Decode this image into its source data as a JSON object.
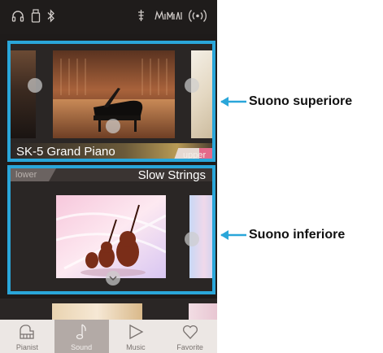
{
  "status_bar": {
    "icons": [
      "headphones-icon",
      "usb-memory-icon",
      "bluetooth-icon",
      "metronome-icon",
      "recorder-icon",
      "wireless-icon"
    ]
  },
  "upper_panel": {
    "name": "SK-5 Grand Piano",
    "tag": "upper"
  },
  "lower_panel": {
    "name": "Slow Strings",
    "tag": "lower"
  },
  "nav": {
    "items": [
      {
        "label": "Pianist",
        "icon": "piano-icon"
      },
      {
        "label": "Sound",
        "icon": "music-note-icon"
      },
      {
        "label": "Music",
        "icon": "play-icon"
      },
      {
        "label": "Favorite",
        "icon": "heart-icon"
      }
    ],
    "active": "Sound"
  },
  "callouts": {
    "upper": "Suono superiore",
    "lower": "Suono inferiore",
    "color": "#2aa6d9"
  },
  "colors": {
    "highlight": "#2aa6d9",
    "background": "#1e1b1a",
    "nav_active": "#b3aaa6"
  }
}
